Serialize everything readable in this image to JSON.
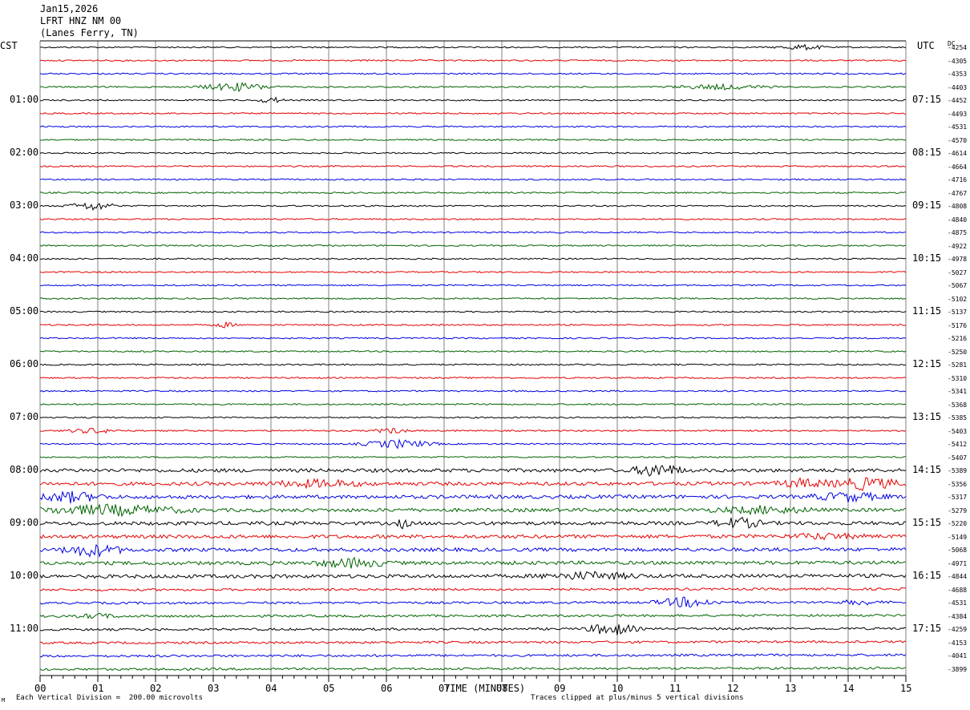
{
  "header": {
    "date": "Jan15,2026",
    "station": "LFRT HNZ NM 00",
    "location": "(Lanes Ferry, TN)"
  },
  "left_tz": "CST",
  "right_tz": "UTC",
  "dc_label": "DC",
  "footer": {
    "corner_mark": "M",
    "scale": "Each Vertical Division =  200.00 microvolts",
    "clip": "Traces clipped at plus/minus 5 vertical divisions"
  },
  "colors": {
    "trace_cycle": [
      "#000000",
      "#e60000",
      "#0000e6",
      "#006400"
    ],
    "grid": "#808080"
  },
  "chart_data": {
    "type": "line",
    "title": "",
    "xlabel": "TIME (MINUTES)",
    "x_ticks": [
      "00",
      "01",
      "02",
      "03",
      "04",
      "05",
      "06",
      "07",
      "08",
      "09",
      "10",
      "11",
      "12",
      "13",
      "14",
      "15"
    ],
    "xlim": [
      0,
      15
    ],
    "minutes_per_line": 15,
    "trace_count": 48,
    "left_hour_labels": [
      "01:00",
      "02:00",
      "03:00",
      "04:00",
      "05:00",
      "06:00",
      "07:00",
      "08:00",
      "09:00",
      "10:00",
      "11:00"
    ],
    "right_hour_labels": [
      "07:15",
      "08:15",
      "09:15",
      "10:15",
      "11:15",
      "12:15",
      "13:15",
      "14:15",
      "15:15",
      "16:15",
      "17:15"
    ],
    "dc_offsets": [
      "-4254",
      "-4305",
      "-4353",
      "-4403",
      "-4452",
      "-4493",
      "-4531",
      "-4570",
      "-4614",
      "-4664",
      "-4716",
      "-4767",
      "-4808",
      "-4840",
      "-4875",
      "-4922",
      "-4978",
      "-5027",
      "-5067",
      "-5102",
      "-5137",
      "-5176",
      "-5216",
      "-5250",
      "-5281",
      "-5310",
      "-5341",
      "-5368",
      "-5385",
      "-5403",
      "-5412",
      "-5407",
      "-5389",
      "-5356",
      "-5317",
      "-5279",
      "-5220",
      "-5149",
      "-5068",
      "-4971",
      "-4844",
      "-4688",
      "-4531",
      "-4384",
      "-4259",
      "-4153",
      "-4041",
      "-3899"
    ],
    "grid": true
  }
}
